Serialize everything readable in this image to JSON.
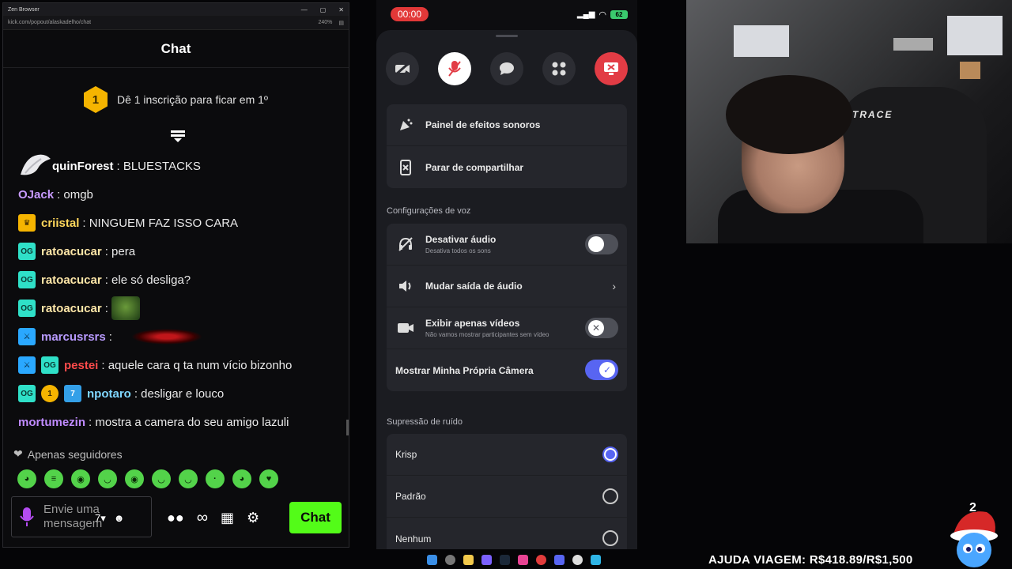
{
  "browser": {
    "app_title": "Zen Browser",
    "url": "kick.com/popout/alaskadelho/chat",
    "zoom": "240%"
  },
  "chat": {
    "header": "Chat",
    "sub_banner": {
      "rank": "1",
      "text": "Dê 1 inscrição para ficar em 1º"
    },
    "messages": [
      {
        "user": "quinForest",
        "color": "#ffffff",
        "text": ": BLUESTACKS",
        "badges": []
      },
      {
        "user": "OJack",
        "color": "#c89bff",
        "text": ": omgb",
        "badges": []
      },
      {
        "user": "criistal",
        "color": "#ffd85c",
        "text": ": NINGUEM FAZ ISSO CARA",
        "badges": [
          "crown"
        ]
      },
      {
        "user": "ratoacucar",
        "color": "#ffe7a8",
        "text": ": pera",
        "badges": [
          "og"
        ]
      },
      {
        "user": "ratoacucar",
        "color": "#ffe7a8",
        "text": ": ele só desliga?",
        "badges": [
          "og"
        ]
      },
      {
        "user": "ratoacucar",
        "color": "#ffe7a8",
        "text": ":",
        "badges": [
          "og"
        ],
        "emote": true
      },
      {
        "user": "marcusrsrs",
        "color": "#b99bff",
        "text": ":",
        "badges": [
          "mod"
        ],
        "emote_wide": true
      },
      {
        "user": "pestei",
        "color": "#ff4b4b",
        "text": ": aquele cara q ta num vício bizonho",
        "badges": [
          "mod",
          "og"
        ]
      },
      {
        "user": "npotaro",
        "color": "#7fd6ff",
        "text": ": desligar e louco",
        "badges": [
          "og",
          "gift",
          "seven"
        ]
      },
      {
        "user": "mortumezin",
        "color": "#c08bff",
        "text": ": mostra a camera do seu amigo lazuli",
        "badges": []
      }
    ],
    "badge_labels": {
      "og": "OG",
      "crown": "♛",
      "mod": "⚔",
      "gift": "1",
      "seven": "7"
    },
    "followers_only": "Apenas seguidores",
    "input_placeholder": "Envie uma mensagem",
    "infinity_label": "∞",
    "send_button": "Chat"
  },
  "phone": {
    "timer": "00:00",
    "battery": "62",
    "menu_items": [
      {
        "label": "Painel de efeitos sonoros",
        "icon": "soundboard-icon"
      },
      {
        "label": "Parar de compartilhar",
        "icon": "stop-share-icon"
      }
    ],
    "voice_settings_title": "Configurações de voz",
    "voice_settings": [
      {
        "label": "Desativar áudio",
        "desc": "Desativa todos os sons",
        "control": "toggle",
        "on": false
      },
      {
        "label": "Mudar saída de áudio",
        "desc": "",
        "control": "chevron",
        "on": false
      },
      {
        "label": "Exibir apenas vídeos",
        "desc": "Não vamos mostrar participantes sem vídeo",
        "control": "toggle-x",
        "on": false
      },
      {
        "label": "Mostrar Minha Própria Câmera",
        "desc": "",
        "control": "toggle",
        "on": true
      }
    ],
    "noise_title": "Supressão de ruído",
    "noise_options": [
      {
        "label": "Krisp",
        "selected": true
      },
      {
        "label": "Padrão",
        "selected": false
      },
      {
        "label": "Nenhum",
        "selected": false
      }
    ]
  },
  "webcam": {
    "chair_brand": "XTRACE"
  },
  "overlay": {
    "donation": "AJUDA VIAGEM: R$418.89/R$1,500",
    "mascot_count": "2"
  },
  "colors": {
    "kick_green": "#53fc18",
    "discord_blurple": "#5865f2",
    "danger_red": "#e23c45"
  }
}
